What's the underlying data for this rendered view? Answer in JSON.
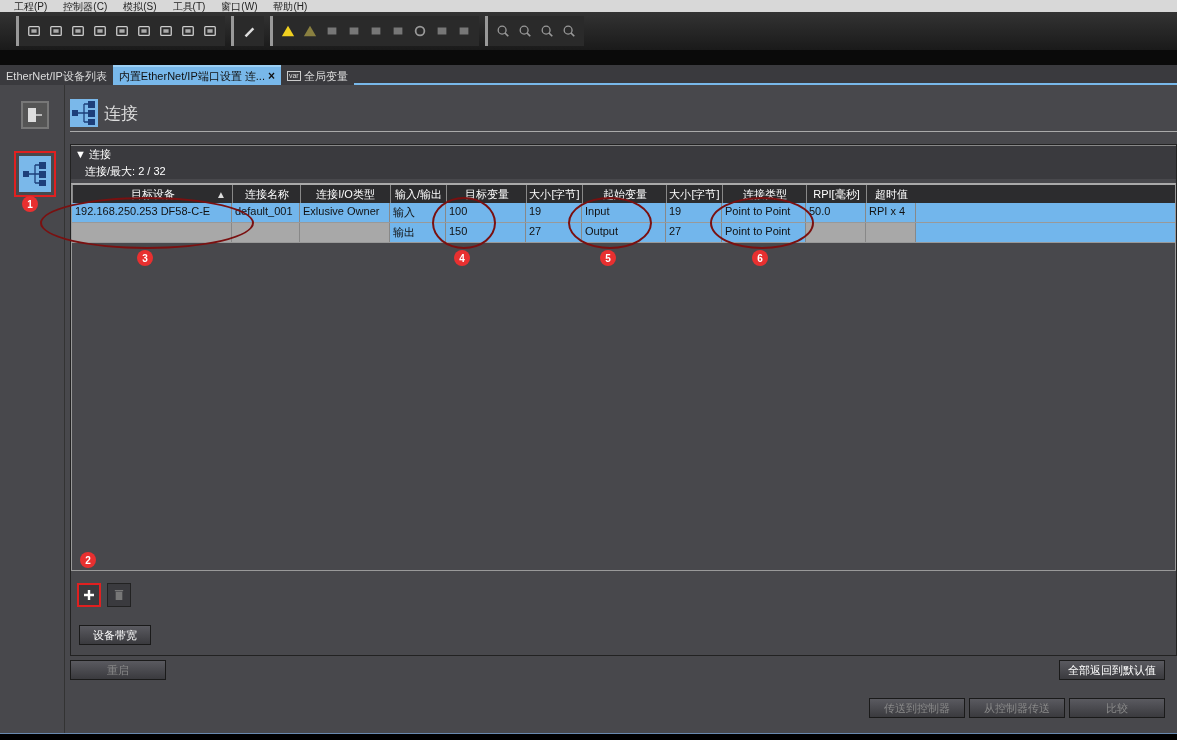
{
  "menu": [
    "工程(P)",
    "控制器(C)",
    "模拟(S)",
    "工具(T)",
    "窗口(W)",
    "帮助(H)"
  ],
  "tabs": [
    {
      "label": "EtherNet/IP设备列表",
      "selected": false
    },
    {
      "label": "内置EtherNet/IP端口设置 连...",
      "selected": true,
      "close": "×"
    },
    {
      "label": "全局变量",
      "selected": false,
      "icon_text": "var"
    }
  ],
  "sidebar": {
    "items": [
      {
        "kind": "device",
        "selected": false,
        "marked": false
      },
      {
        "kind": "connection",
        "selected": true,
        "marked": true
      }
    ]
  },
  "page_title": "连接",
  "section": {
    "title": "▼ 连接",
    "summary": "连接/最大: 2 / 32"
  },
  "table": {
    "columns": [
      "目标设备",
      "连接名称",
      "连接I/O类型",
      "输入/输出",
      "目标变量",
      "大小[字节]",
      "起始变量",
      "大小[字节]",
      "连接类型",
      "RPI[毫秒]",
      "超时值"
    ],
    "sort_mark": "▲",
    "rows": [
      {
        "selected": true,
        "cells": [
          "192.168.250.253 DF58-C-E",
          "default_001",
          "Exlusive Owner",
          "输入",
          "100",
          "19",
          "Input",
          "19",
          "Point to Point",
          "50.0",
          "RPI x 4"
        ]
      },
      {
        "selected": true,
        "cells": [
          "",
          "",
          "",
          "输出",
          "150",
          "27",
          "Output",
          "27",
          "Point to Point",
          "",
          ""
        ]
      }
    ]
  },
  "add_button": {
    "marked": true
  },
  "bandwidth_button": "设备带宽",
  "restart_button": {
    "label": "重启",
    "disabled": true
  },
  "reset_button": {
    "label": "全部返回到默认值",
    "disabled": false
  },
  "bottom_buttons": [
    {
      "label": "传送到控制器",
      "disabled": true
    },
    {
      "label": "从控制器传送",
      "disabled": true
    },
    {
      "label": "比较",
      "disabled": true
    }
  ],
  "annotations": [
    {
      "label": "1"
    },
    {
      "label": "2"
    },
    {
      "label": "3"
    },
    {
      "label": "4"
    },
    {
      "label": "5"
    },
    {
      "label": "6"
    }
  ]
}
